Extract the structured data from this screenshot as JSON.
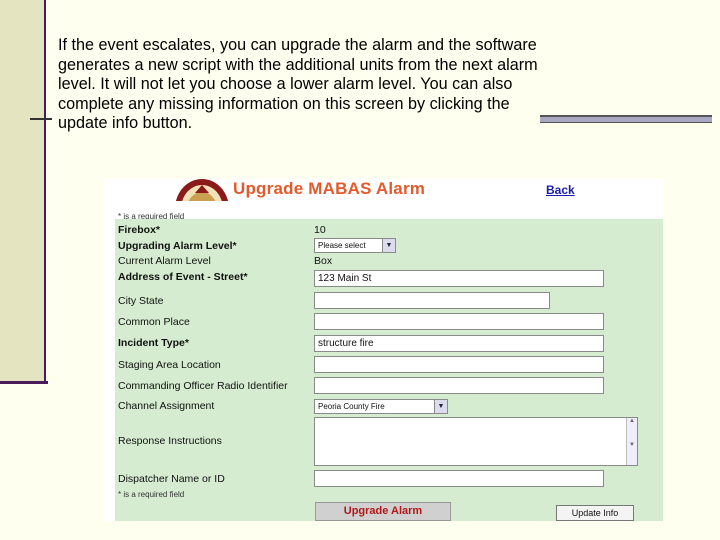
{
  "slide": {
    "caption": "If the event escalates, you can upgrade the alarm and the software generates a new script with the additional units from the next alarm level.  It will not let you choose a lower alarm level.  You can also complete any missing information on this screen by clicking the update info button."
  },
  "screen": {
    "title": "Upgrade MABAS Alarm",
    "back_link": "Back",
    "required_note": "* is a required field",
    "fields": {
      "firebox": {
        "label": "Firebox*",
        "value": "10"
      },
      "upgrading_alarm_level": {
        "label": "Upgrading Alarm Level*",
        "selected": "Please select"
      },
      "current_alarm_level": {
        "label": "Current Alarm Level",
        "value": "Box"
      },
      "address": {
        "label": "Address of Event - Street*",
        "value": "123 Main St"
      },
      "city_state": {
        "label": "City  State",
        "value": ""
      },
      "common_place": {
        "label": "Common Place",
        "value": ""
      },
      "incident_type": {
        "label": "Incident Type*",
        "value": "structure fire"
      },
      "staging_area": {
        "label": "Staging Area Location",
        "value": ""
      },
      "commanding_officer": {
        "label": "Commanding Officer Radio Identifier",
        "value": ""
      },
      "channel_assignment": {
        "label": "Channel Assignment",
        "selected": "Peoria County Fire"
      },
      "response_instructions": {
        "label": "Response Instructions",
        "value": ""
      },
      "dispatcher": {
        "label": "Dispatcher Name or ID",
        "value": ""
      }
    },
    "buttons": {
      "upgrade": "Upgrade Alarm",
      "update": "Update Info"
    }
  },
  "colors": {
    "title": "#e25b2e",
    "form_bg": "#d6ecd0",
    "link": "#1a1aa8"
  }
}
